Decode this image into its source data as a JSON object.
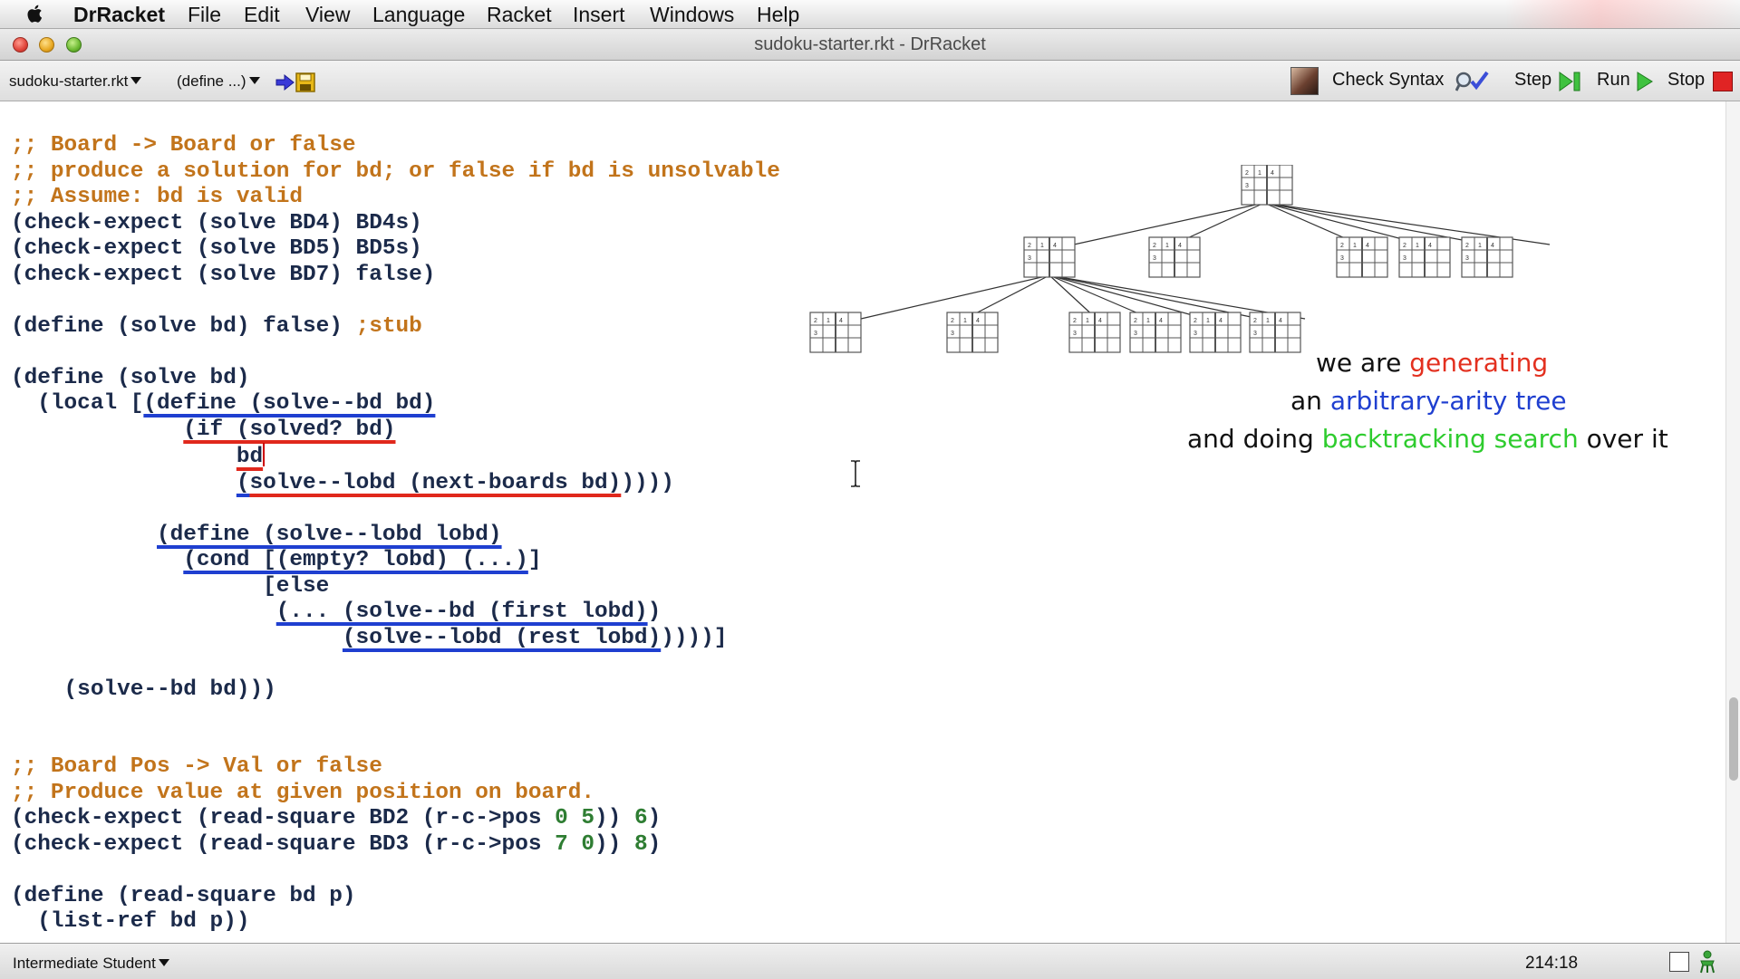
{
  "menubar": {
    "app": "DrRacket",
    "items": [
      "File",
      "Edit",
      "View",
      "Language",
      "Racket",
      "Insert",
      "Windows",
      "Help"
    ]
  },
  "window": {
    "title": "sudoku-starter.rkt - DrRacket"
  },
  "toolbar": {
    "file_menu": "sudoku-starter.rkt",
    "define_menu": "(define ...)",
    "check_syntax": "Check Syntax",
    "step": "Step",
    "run": "Run",
    "stop": "Stop"
  },
  "code": {
    "l1": ";; Board -> Board or false",
    "l2": ";; produce a solution for bd; or false if bd is unsolvable",
    "l3": ";; Assume: bd is valid",
    "l4": "(check-expect (solve BD4) BD4s)",
    "l5": "(check-expect (solve BD5) BD5s)",
    "l6": "(check-expect (solve BD7) false)",
    "l8a": "(define (solve bd) false) ",
    "l8b": ";stub",
    "l10": "(define (solve bd)",
    "l11a": "  (local [",
    "l11b": "(define (solve--bd bd)",
    "l12a": "             ",
    "l12b": "(if (solved? bd)",
    "l13a": "                 ",
    "l13b": "bd",
    "l14a": "                 ",
    "l14b": "(",
    "l14c": "solve--lobd (next-boards bd)",
    "l14d": "))))",
    "l16a": "           ",
    "l16b": "(define (solve--lobd lobd)",
    "l17a": "             ",
    "l17b": "(cond [(empty? lobd) (...)",
    "l17c": "]",
    "l18": "                   [else",
    "l19a": "                    ",
    "l19b": "(... (solve--bd (first lobd)",
    "l19c": ")",
    "l20a": "                         ",
    "l20b": "(solve--lobd (rest lobd)",
    "l20c": "))))]",
    "l22": "    (solve--bd bd)))",
    "l25": ";; Board Pos -> Val or false",
    "l26": ";; Produce value at given position on board.",
    "l27a": "(check-expect (read-square BD2 (r-c->pos ",
    "l27n1": "0",
    "l27s": " ",
    "l27n2": "5",
    "l27b": ")) ",
    "l27n3": "6",
    "l27c": ")",
    "l28a": "(check-expect (read-square BD3 (r-c->pos ",
    "l28n1": "7",
    "l28s": " ",
    "l28n2": "0",
    "l28b": ")) ",
    "l28n3": "8",
    "l28c": ")",
    "l30": "(define (read-square bd p)",
    "l31": "  (list-ref bd p))"
  },
  "annotation": {
    "line1_a": "we are ",
    "line1_b": "generating",
    "line2_a": "an ",
    "line2_b": "arbitrary-arity tree",
    "line3_a": "and doing ",
    "line3_b": "backtracking search",
    "line3_c": " over it"
  },
  "statusbar": {
    "language": "Intermediate Student",
    "position": "214:18"
  },
  "colors": {
    "comment": "#c2741b",
    "code": "#1b2a4a",
    "number": "#2e7d32",
    "underline_blue": "#1f3fd0",
    "underline_red": "#e0281c",
    "annot_red": "#e3301f",
    "annot_blue": "#1f3fd0",
    "annot_green": "#2ecc2e"
  }
}
